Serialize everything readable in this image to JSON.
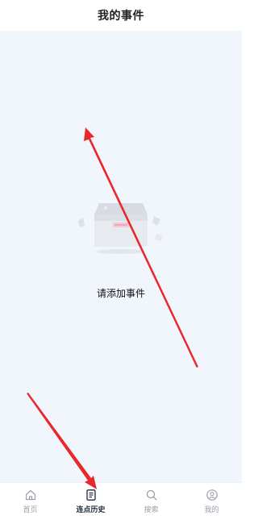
{
  "header": {
    "title": "我的事件"
  },
  "empty_state": {
    "message": "请添加事件",
    "illustration": "empty-box-icon"
  },
  "tabbar": {
    "tabs": [
      {
        "label": "首页",
        "icon": "home-icon",
        "active": false
      },
      {
        "label": "连点历史",
        "icon": "history-list-icon",
        "active": true
      },
      {
        "label": "搜索",
        "icon": "search-icon",
        "active": false
      },
      {
        "label": "我的",
        "icon": "profile-icon",
        "active": false
      }
    ]
  },
  "colors": {
    "content_bg": "#f1f5fc",
    "tab_inactive": "#9aa0a8",
    "tab_active": "#1f2a3a",
    "annotation_arrow": "#e8282b"
  }
}
